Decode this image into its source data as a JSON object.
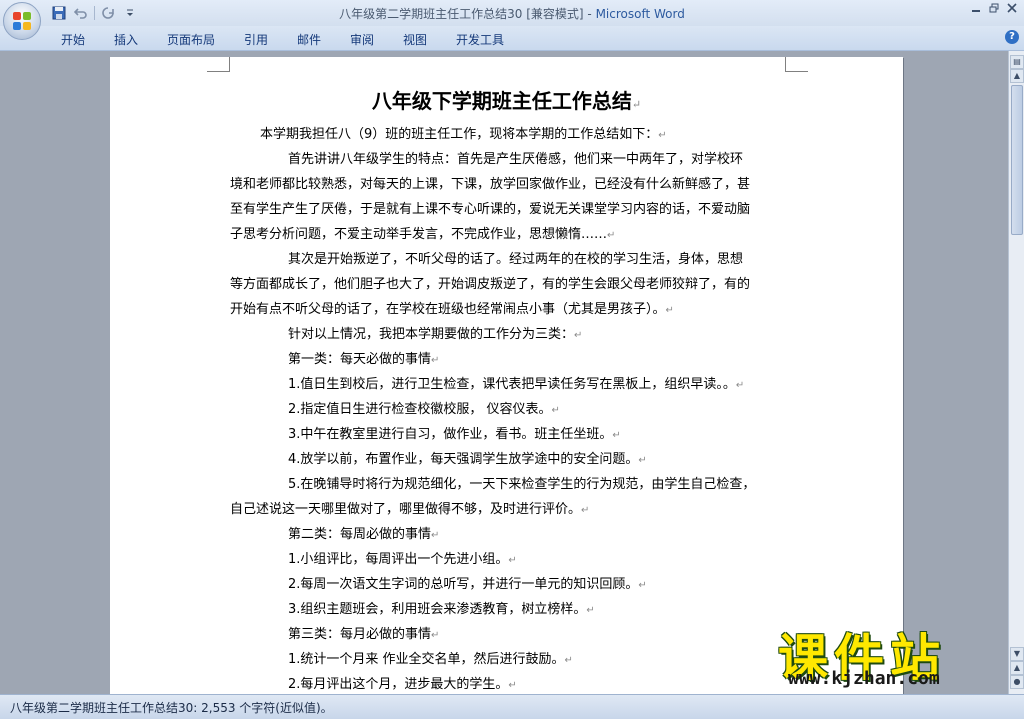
{
  "window": {
    "title": "八年级第二学期班主任工作总结30 [兼容模式]",
    "app_name": "Microsoft Word"
  },
  "quick_access": {
    "icons": [
      "save-icon",
      "undo-icon",
      "redo-icon",
      "customize-icon"
    ]
  },
  "ribbon": {
    "tabs": [
      "开始",
      "插入",
      "页面布局",
      "引用",
      "邮件",
      "审阅",
      "视图",
      "开发工具"
    ]
  },
  "document": {
    "title": "八年级下学期班主任工作总结",
    "lines": [
      "本学期我担任八（9）班的班主任工作，现将本学期的工作总结如下：",
      "首先讲讲八年级学生的特点：首先是产生厌倦感，他们来一中两年了，对学校环",
      "境和老师都比较熟悉，对每天的上课，下课，放学回家做作业，已经没有什么新鲜感了，甚",
      "至有学生产生了厌倦，于是就有上课不专心听课的，爱说无关课堂学习内容的话，不爱动脑",
      "子思考分析问题，不爱主动举手发言，不完成作业，思想懒惰……",
      "其次是开始叛逆了，不听父母的话了。经过两年的在校的学习生活，身体，思想",
      "等方面都成长了，他们胆子也大了，开始调皮叛逆了，有的学生会跟父母老师狡辩了，有的",
      "开始有点不听父母的话了，在学校在班级也经常闹点小事（尤其是男孩子）。",
      "针对以上情况，我把本学期要做的工作分为三类：",
      "第一类：每天必做的事情",
      "1.值日生到校后，进行卫生检查，课代表把早读任务写在黑板上，组织早读。。",
      "2.指定值日生进行检查校徽校服，  仪容仪表。",
      "3.中午在教室里进行自习，做作业，看书。班主任坐班。",
      "4.放学以前，布置作业，每天强调学生放学途中的安全问题。",
      "5.在晚铺导时将行为规范细化，一天下来检查学生的行为规范，由学生自己检查，",
      "自己述说这一天哪里做对了，哪里做得不够，及时进行评价。",
      "第二类：每周必做的事情",
      "1.小组评比，每周评出一个先进小组。",
      "2.每周一次语文生字词的总听写，并进行一单元的知识回顾。",
      "3.组织主题班会，利用班会来渗透教育，树立榜样。",
      "第三类：每月必做的事情",
      "1.统计一个月来  作业全交名单，然后进行鼓励。",
      "2.每月评出这个月，进步最大的学生。"
    ]
  },
  "watermark": {
    "text": "课件站",
    "url": "www.kjzhan.com"
  },
  "statusbar": {
    "text": "八年级第二学期班主任工作总结30: 2,553 个字符(近似值)。"
  }
}
